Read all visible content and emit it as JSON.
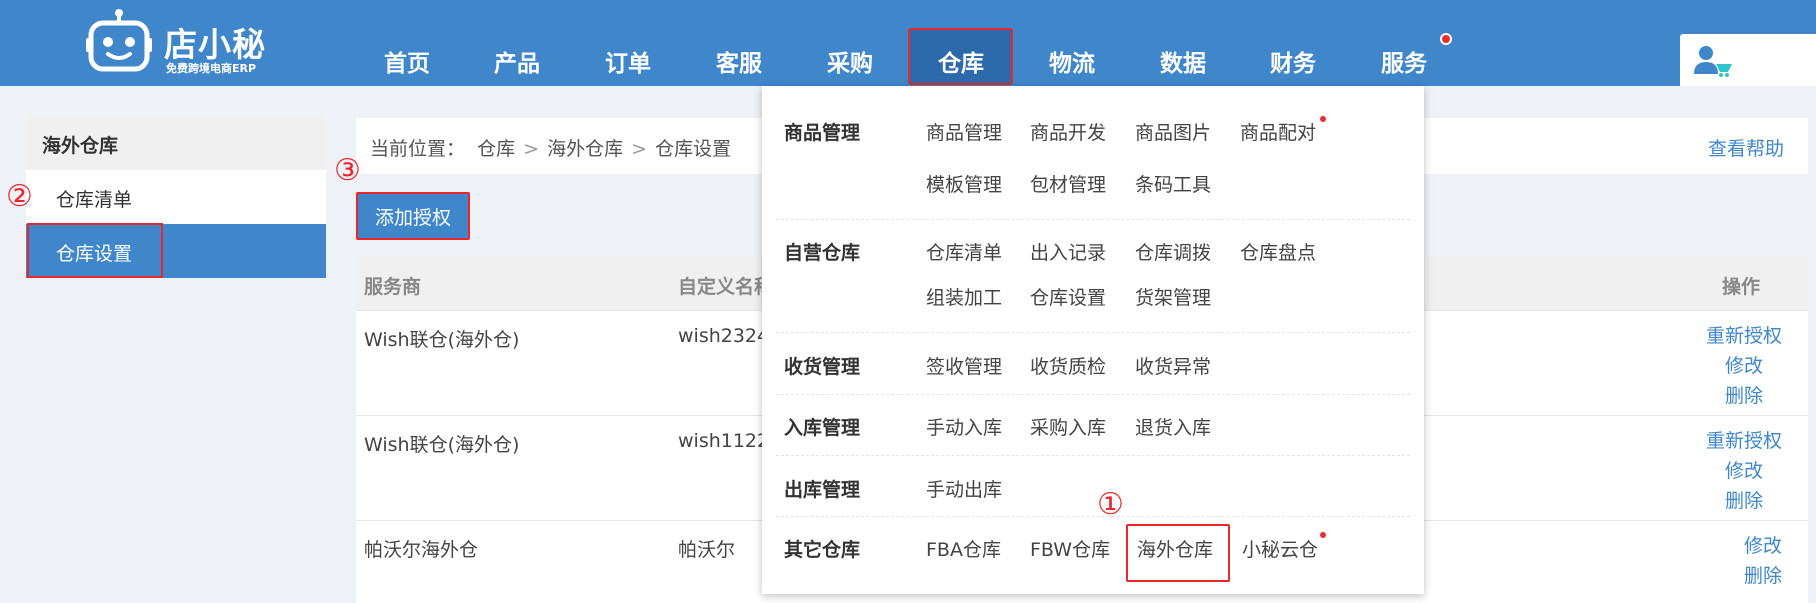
{
  "logo": {
    "name": "店小秘",
    "subtitle": "免费跨境电商ERP"
  },
  "nav": {
    "items": [
      "首页",
      "产品",
      "订单",
      "客服",
      "采购",
      "仓库",
      "物流",
      "数据",
      "财务",
      "服务"
    ],
    "active": "仓库"
  },
  "sidebar": {
    "heading": "海外仓库",
    "items": [
      "仓库清单",
      "仓库设置"
    ],
    "active": "仓库设置"
  },
  "breadcrumb": {
    "label": "当前位置：",
    "path": [
      "仓库",
      "海外仓库",
      "仓库设置"
    ],
    "separator": ">",
    "help": "查看帮助"
  },
  "add_button": "添加授权",
  "table": {
    "headers": [
      "服务商",
      "自定义名称",
      "操作"
    ],
    "rows": [
      {
        "provider": "Wish联仓(海外仓)",
        "name": "wish2324",
        "ops": [
          "重新授权",
          "修改",
          "删除"
        ]
      },
      {
        "provider": "Wish联仓(海外仓)",
        "name": "wish1122",
        "ops": [
          "重新授权",
          "修改",
          "删除"
        ]
      },
      {
        "provider": "帕沃尔海外仓",
        "name": "帕沃尔",
        "ops": [
          "修改",
          "删除"
        ]
      }
    ]
  },
  "dropdown": {
    "groups": [
      {
        "category": "商品管理",
        "links": [
          "商品管理",
          "商品开发",
          "商品图片",
          "商品配对",
          "模板管理",
          "包材管理",
          "条码工具"
        ]
      },
      {
        "category": "自营仓库",
        "links": [
          "仓库清单",
          "出入记录",
          "仓库调拨",
          "仓库盘点",
          "组装加工",
          "仓库设置",
          "货架管理"
        ]
      },
      {
        "category": "收货管理",
        "links": [
          "签收管理",
          "收货质检",
          "收货异常"
        ]
      },
      {
        "category": "入库管理",
        "links": [
          "手动入库",
          "采购入库",
          "退货入库"
        ]
      },
      {
        "category": "出库管理",
        "links": [
          "手动出库"
        ]
      },
      {
        "category": "其它仓库",
        "links": [
          "FBA仓库",
          "FBW仓库",
          "海外仓库",
          "小秘云仓"
        ]
      }
    ]
  },
  "annotations": {
    "step1": "①",
    "step2": "②",
    "step3": "③"
  },
  "colors": {
    "brand": "#3f86cb",
    "highlight": "#e8262c"
  },
  "icons": {
    "logo": "robot-icon",
    "user": "user-cart-icon"
  }
}
